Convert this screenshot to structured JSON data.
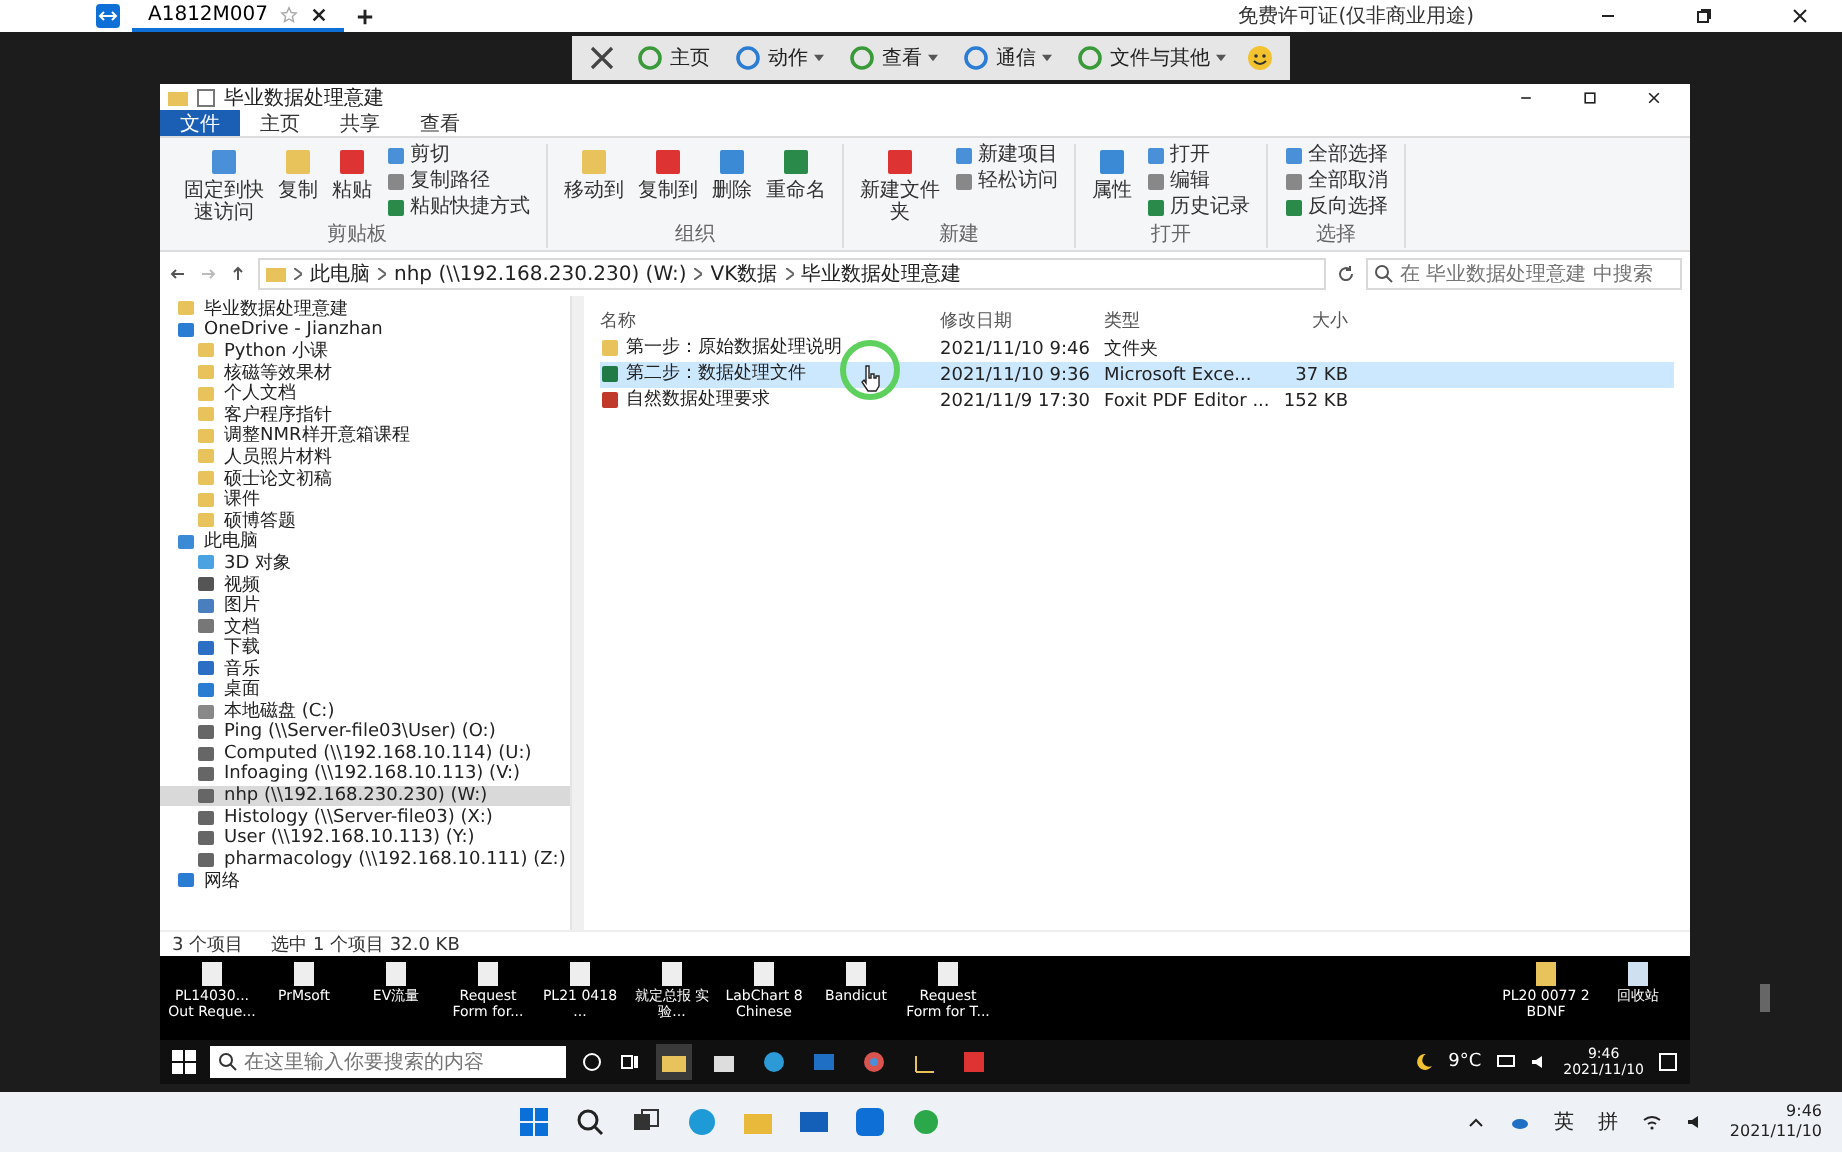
{
  "remote_tab": {
    "title": "A1812M007",
    "favorite": false
  },
  "top_notice": "免费许可证(仅非商业用途)",
  "remote_toolbar": [
    {
      "label": "主页",
      "has_menu": false
    },
    {
      "label": "动作",
      "has_menu": true
    },
    {
      "label": "查看",
      "has_menu": true
    },
    {
      "label": "通信",
      "has_menu": true
    },
    {
      "label": "文件与其他",
      "has_menu": true
    }
  ],
  "explorer": {
    "title": "毕业数据处理意建",
    "ribbon_tabs": [
      {
        "label": "文件",
        "selected": true
      },
      {
        "label": "主页",
        "selected": false
      },
      {
        "label": "共享",
        "selected": false
      },
      {
        "label": "查看",
        "selected": false
      }
    ],
    "ribbon_groups": [
      {
        "label": "剪贴板",
        "buttons": [
          {
            "label": "固定到快速访问",
            "kind": "large"
          },
          {
            "label": "复制",
            "kind": "large"
          },
          {
            "label": "粘贴",
            "kind": "large"
          },
          {
            "label": "剪切",
            "kind": "small"
          },
          {
            "label": "复制路径",
            "kind": "small"
          },
          {
            "label": "粘贴快捷方式",
            "kind": "small"
          }
        ]
      },
      {
        "label": "组织",
        "buttons": [
          {
            "label": "移动到",
            "kind": "large"
          },
          {
            "label": "复制到",
            "kind": "large"
          },
          {
            "label": "删除",
            "kind": "large"
          },
          {
            "label": "重命名",
            "kind": "large"
          }
        ]
      },
      {
        "label": "新建",
        "buttons": [
          {
            "label": "新建文件夹",
            "kind": "large"
          },
          {
            "label": "新建项目",
            "kind": "small"
          },
          {
            "label": "轻松访问",
            "kind": "small"
          }
        ]
      },
      {
        "label": "打开",
        "buttons": [
          {
            "label": "属性",
            "kind": "large"
          },
          {
            "label": "打开",
            "kind": "small"
          },
          {
            "label": "编辑",
            "kind": "small"
          },
          {
            "label": "历史记录",
            "kind": "small"
          }
        ]
      },
      {
        "label": "选择",
        "buttons": [
          {
            "label": "全部选择",
            "kind": "small"
          },
          {
            "label": "全部取消",
            "kind": "small"
          },
          {
            "label": "反向选择",
            "kind": "small"
          }
        ]
      }
    ],
    "address": [
      "此电脑",
      "nhp (\\\\192.168.230.230) (W:)",
      "VK数据",
      "毕业数据处理意建"
    ],
    "search_placeholder": "在 毕业数据处理意建 中搜索",
    "nav": [
      {
        "label": "毕业数据处理意建",
        "kind": "folder",
        "selected": false
      },
      {
        "label": "OneDrive - Jianzhan",
        "kind": "onedrive",
        "selected": false,
        "children": [
          {
            "label": "Python 小课",
            "kind": "folder",
            "selected": false
          },
          {
            "label": "核磁等效果材",
            "kind": "folder",
            "selected": false
          },
          {
            "label": "个人文档",
            "kind": "folder",
            "selected": false
          },
          {
            "label": "客户程序指针",
            "kind": "folder",
            "selected": false
          },
          {
            "label": "调整NMR样开意箱课程",
            "kind": "folder",
            "selected": false
          },
          {
            "label": "人员照片材料",
            "kind": "folder",
            "selected": false
          },
          {
            "label": "硕士论文初稿",
            "kind": "folder",
            "selected": false
          },
          {
            "label": "课件",
            "kind": "folder",
            "selected": false
          },
          {
            "label": "硕博答题",
            "kind": "folder",
            "selected": false
          }
        ]
      },
      {
        "label": "此电脑",
        "kind": "pc",
        "selected": false,
        "children": [
          {
            "label": "3D 对象",
            "kind": "obj3d",
            "selected": false
          },
          {
            "label": "视频",
            "kind": "video",
            "selected": false
          },
          {
            "label": "图片",
            "kind": "picture",
            "selected": false
          },
          {
            "label": "文档",
            "kind": "doc",
            "selected": false
          },
          {
            "label": "下载",
            "kind": "download",
            "selected": false
          },
          {
            "label": "音乐",
            "kind": "music",
            "selected": false
          },
          {
            "label": "桌面",
            "kind": "desktop",
            "selected": false
          },
          {
            "label": "本地磁盘 (C:)",
            "kind": "disk",
            "selected": false
          },
          {
            "label": "Ping (\\\\Server-file03\\User) (O:)",
            "kind": "netdrive",
            "selected": false
          },
          {
            "label": "Computed (\\\\192.168.10.114) (U:)",
            "kind": "netdrive",
            "selected": false
          },
          {
            "label": "Infoaging (\\\\192.168.10.113) (V:)",
            "kind": "netdrive",
            "selected": false
          },
          {
            "label": "nhp (\\\\192.168.230.230) (W:)",
            "kind": "netdrive",
            "selected": true
          },
          {
            "label": "Histology (\\\\Server-file03) (X:)",
            "kind": "netdrive",
            "selected": false
          },
          {
            "label": "User (\\\\192.168.10.113) (Y:)",
            "kind": "netdrive",
            "selected": false
          },
          {
            "label": "pharmacology (\\\\192.168.10.111) (Z:)",
            "kind": "netdrive",
            "selected": false
          }
        ]
      },
      {
        "label": "网络",
        "kind": "network",
        "selected": false
      }
    ],
    "columns": [
      "名称",
      "修改日期",
      "类型",
      "大小"
    ],
    "files": [
      {
        "name": "第一步：原始数据处理说明",
        "kind": "folder",
        "date": "2021/11/10 9:46",
        "type": "文件夹",
        "selected": false
      },
      {
        "name": "第二步：数据处理文件",
        "kind": "excel",
        "date": "2021/11/10 9:36",
        "type": "Microsoft Exce...",
        "size": "37 KB",
        "selected": true
      },
      {
        "name": "自然数据处理要求",
        "kind": "pdf",
        "date": "2021/11/9 17:30",
        "type": "Foxit PDF Editor ...",
        "size": "152 KB",
        "selected": false
      }
    ],
    "status": [
      "3 个项目",
      "选中 1 个项目 32.0 KB"
    ]
  },
  "desktop": {
    "left_icons": [
      "PL14030... Out Reque...",
      "PrMsoft",
      "EV流量",
      "Request Form for...",
      "PL21 0418 ...",
      "就定总报 实验...",
      "LabChart 8 Chinese",
      "Bandicut",
      "Request Form for T..."
    ],
    "right_icons": [
      "PL20 0077 2 BDNF",
      "回收站"
    ]
  },
  "remote_taskbar": {
    "search_placeholder": "在这里输入你要搜索的内容",
    "weather": "9°C",
    "time": "9:46",
    "date": "2021/11/10"
  },
  "host_taskbar": {
    "ime": [
      "英",
      "拼"
    ],
    "time": "9:46",
    "date": "2021/11/10"
  }
}
